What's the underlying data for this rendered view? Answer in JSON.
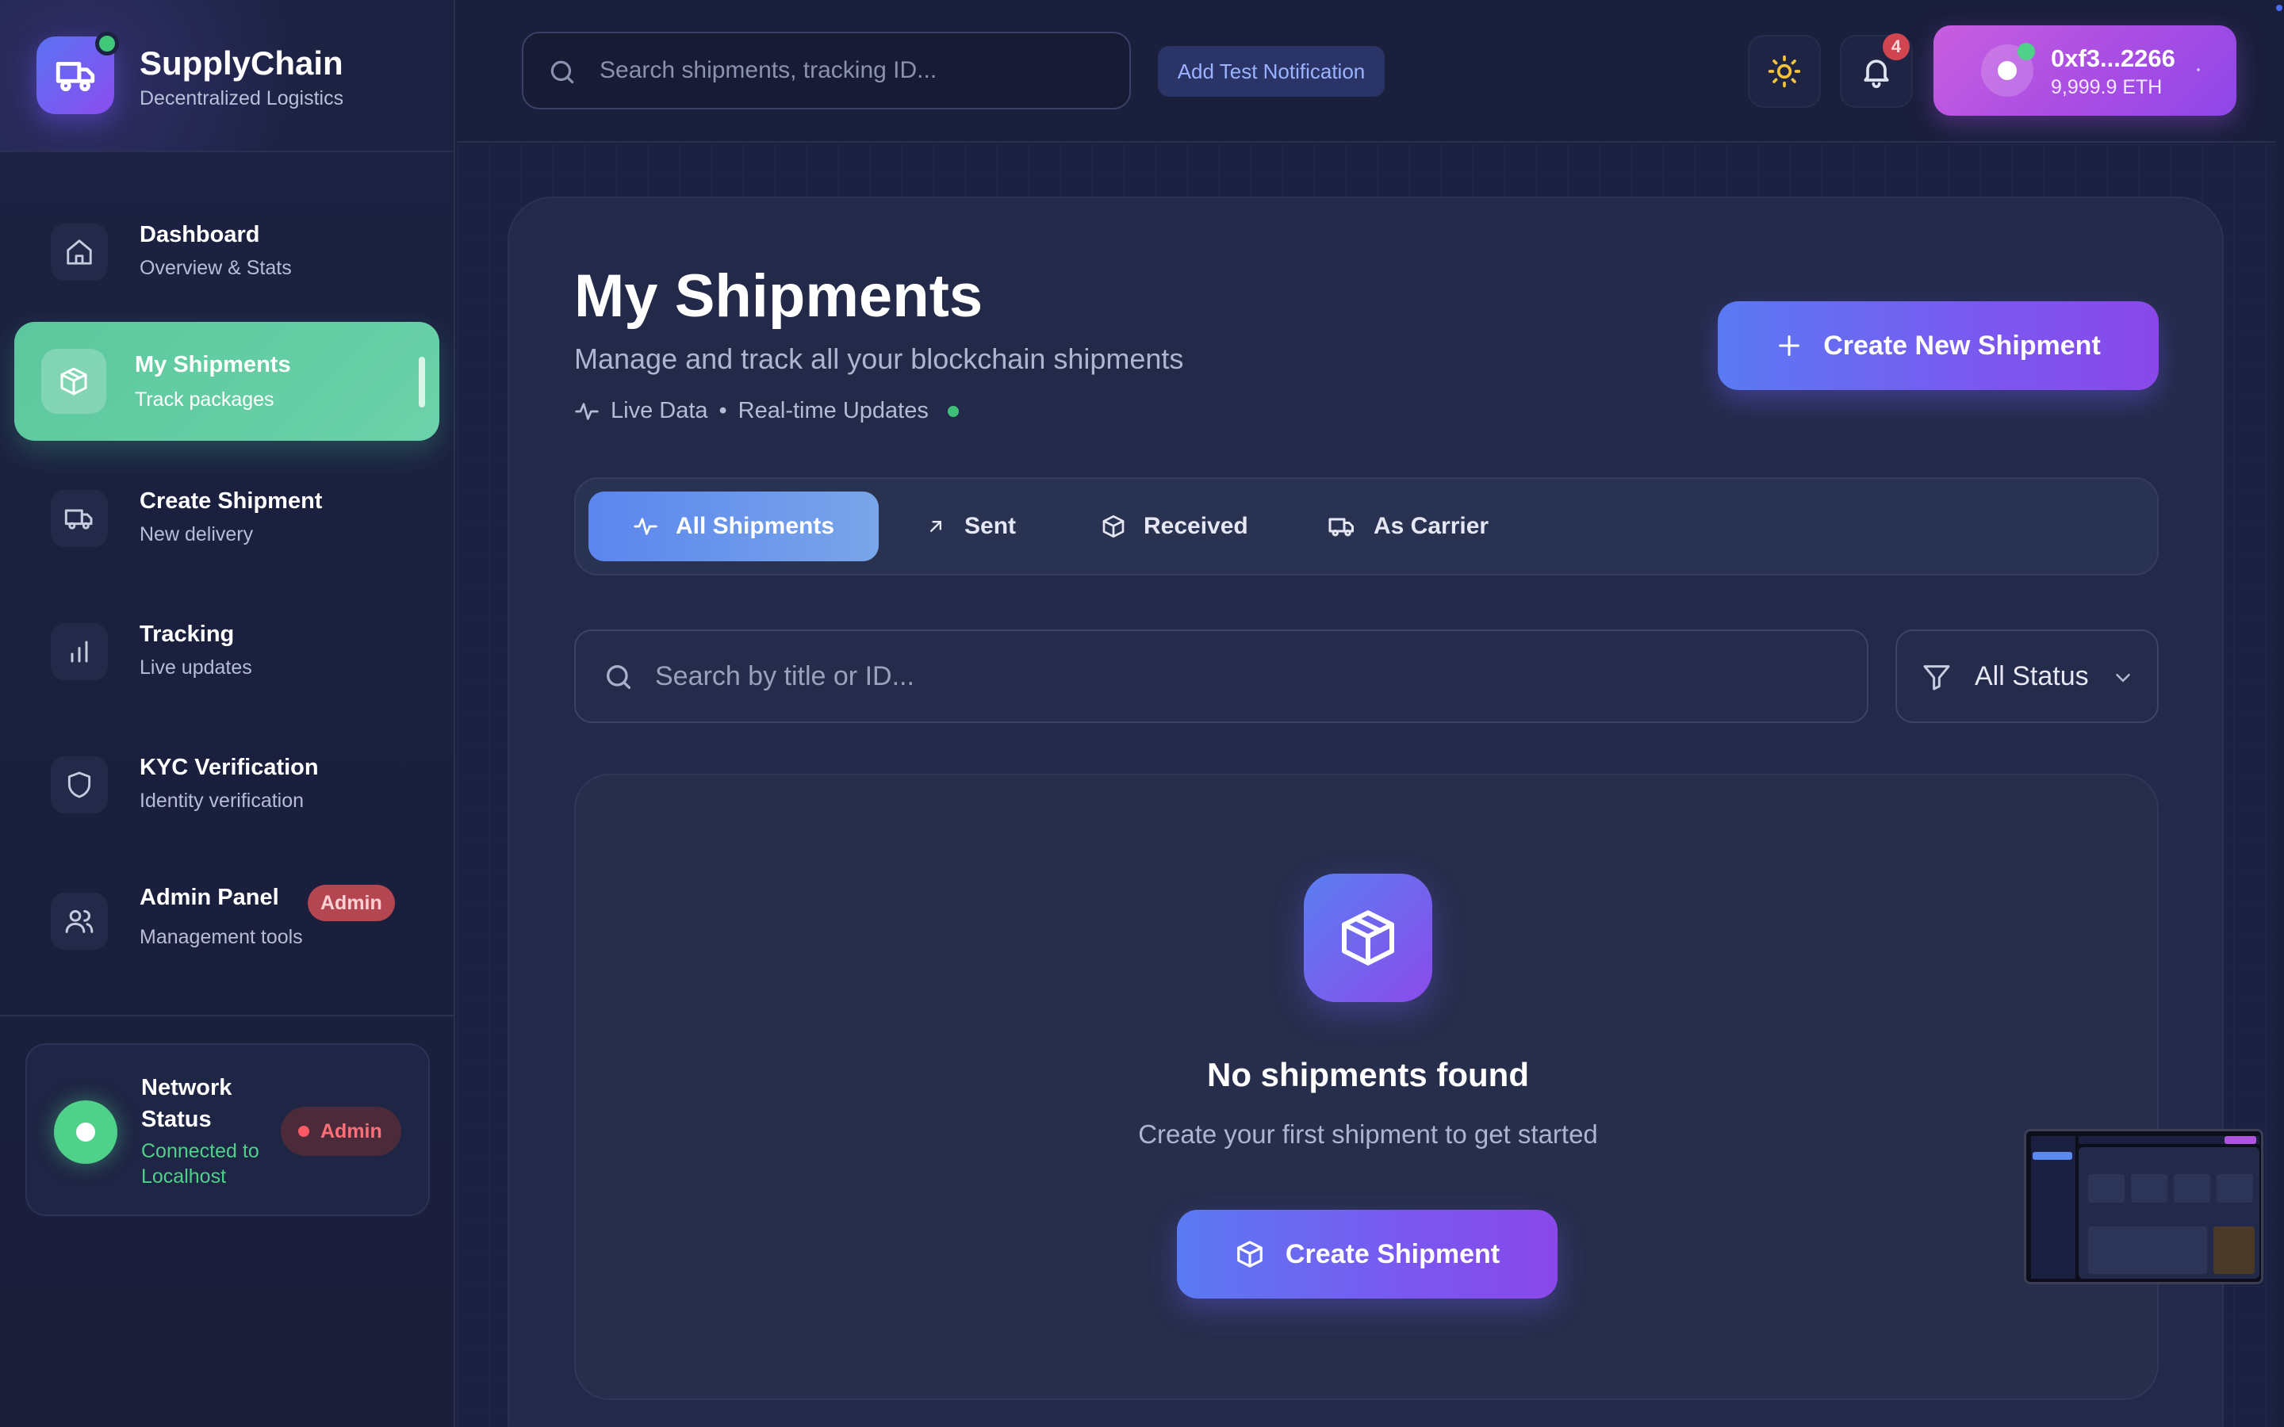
{
  "brand": {
    "title": "SupplyChain",
    "subtitle": "Decentralized Logistics",
    "icon": "truck-icon"
  },
  "sidebar": {
    "items": [
      {
        "title": "Dashboard",
        "subtitle": "Overview & Stats",
        "icon": "home-icon",
        "active": false
      },
      {
        "title": "My Shipments",
        "subtitle": "Track packages",
        "icon": "package-icon",
        "active": true
      },
      {
        "title": "Create Shipment",
        "subtitle": "New delivery",
        "icon": "truck-icon",
        "active": false
      },
      {
        "title": "Tracking",
        "subtitle": "Live updates",
        "icon": "bar-chart-icon",
        "active": false
      },
      {
        "title": "KYC Verification",
        "subtitle": "Identity verification",
        "icon": "shield-icon",
        "active": false
      },
      {
        "title": "Admin Panel",
        "subtitle": "Management tools",
        "icon": "users-icon",
        "active": false,
        "badge": "Admin"
      }
    ],
    "network": {
      "title": "Network Status",
      "status": "Connected to Localhost",
      "badge": "Admin"
    }
  },
  "header": {
    "search_placeholder": "Search shipments, tracking ID...",
    "test_notification_label": "Add Test Notification",
    "notification_count": "4",
    "wallet": {
      "address": "0xf3...2266",
      "balance": "9,999.9 ETH"
    }
  },
  "main": {
    "title": "My Shipments",
    "subtitle": "Manage and track all your blockchain shipments",
    "live_label": "Live Data",
    "separator": "•",
    "realtime_label": "Real-time Updates",
    "create_new_label": "Create New Shipment",
    "tabs": [
      {
        "label": "All Shipments",
        "icon": "activity-icon",
        "active": true
      },
      {
        "label": "Sent",
        "icon": "arrow-up-right-icon",
        "active": false
      },
      {
        "label": "Received",
        "icon": "package-icon",
        "active": false
      },
      {
        "label": "As Carrier",
        "icon": "truck-icon",
        "active": false
      }
    ],
    "search_placeholder": "Search by title or ID...",
    "status_filter": {
      "selected": "All Status"
    },
    "empty": {
      "title": "No shipments found",
      "subtitle": "Create your first shipment to get started",
      "button_label": "Create Shipment"
    }
  },
  "colors": {
    "background": "#1a1f3c",
    "panel": "#232a49",
    "accent_gradient_start": "#5a7af3",
    "accent_gradient_end": "#8a48ea",
    "active_nav": "#5cc79d",
    "success": "#4fd18a",
    "danger": "#d0454f",
    "wallet": "#a94de3"
  }
}
